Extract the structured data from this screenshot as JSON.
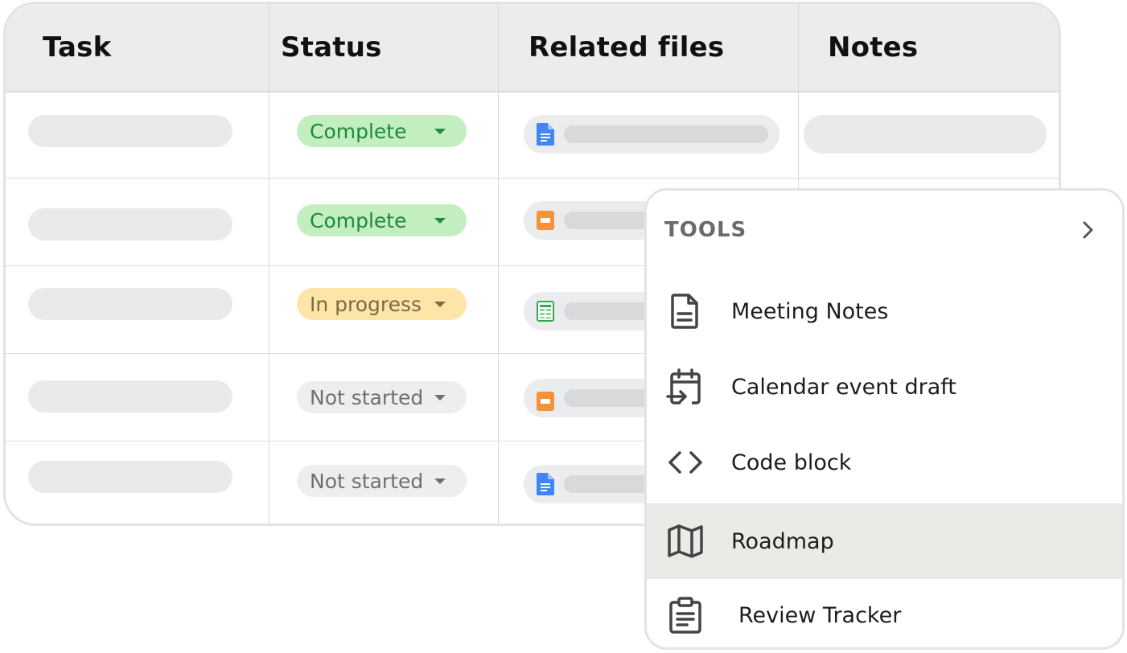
{
  "table": {
    "columns": {
      "task": "Task",
      "status": "Status",
      "related_files": "Related files",
      "notes": "Notes"
    },
    "rows": [
      {
        "status": "Complete",
        "status_kind": "complete",
        "file_icon": "google-docs-icon"
      },
      {
        "status": "Complete",
        "status_kind": "complete",
        "file_icon": "google-slides-icon"
      },
      {
        "status": "In progress",
        "status_kind": "in-progress",
        "file_icon": "google-sheets-icon"
      },
      {
        "status": "Not started",
        "status_kind": "not-started",
        "file_icon": "google-slides-icon"
      },
      {
        "status": "Not started",
        "status_kind": "not-started",
        "file_icon": "google-docs-icon"
      }
    ]
  },
  "tools_menu": {
    "title": "TOOLS",
    "items": [
      {
        "label": "Meeting Notes",
        "icon": "document-icon",
        "highlighted": false
      },
      {
        "label": "Calendar event draft",
        "icon": "calendar-event-icon",
        "highlighted": false
      },
      {
        "label": "Code block",
        "icon": "code-icon",
        "highlighted": false
      },
      {
        "label": "Roadmap",
        "icon": "map-icon",
        "highlighted": true
      },
      {
        "label": "Review Tracker",
        "icon": "clipboard-icon",
        "highlighted": false
      }
    ]
  },
  "colors": {
    "complete_bg": "#c3eebf",
    "complete_text": "#1e8a3c",
    "in_progress_bg": "#fde5a8",
    "not_started_bg": "#eeeeee",
    "menu_highlight": "#ebeae6",
    "docs_blue": "#4285f4",
    "slides_orange": "#f4913b",
    "sheets_green": "#34a853"
  }
}
